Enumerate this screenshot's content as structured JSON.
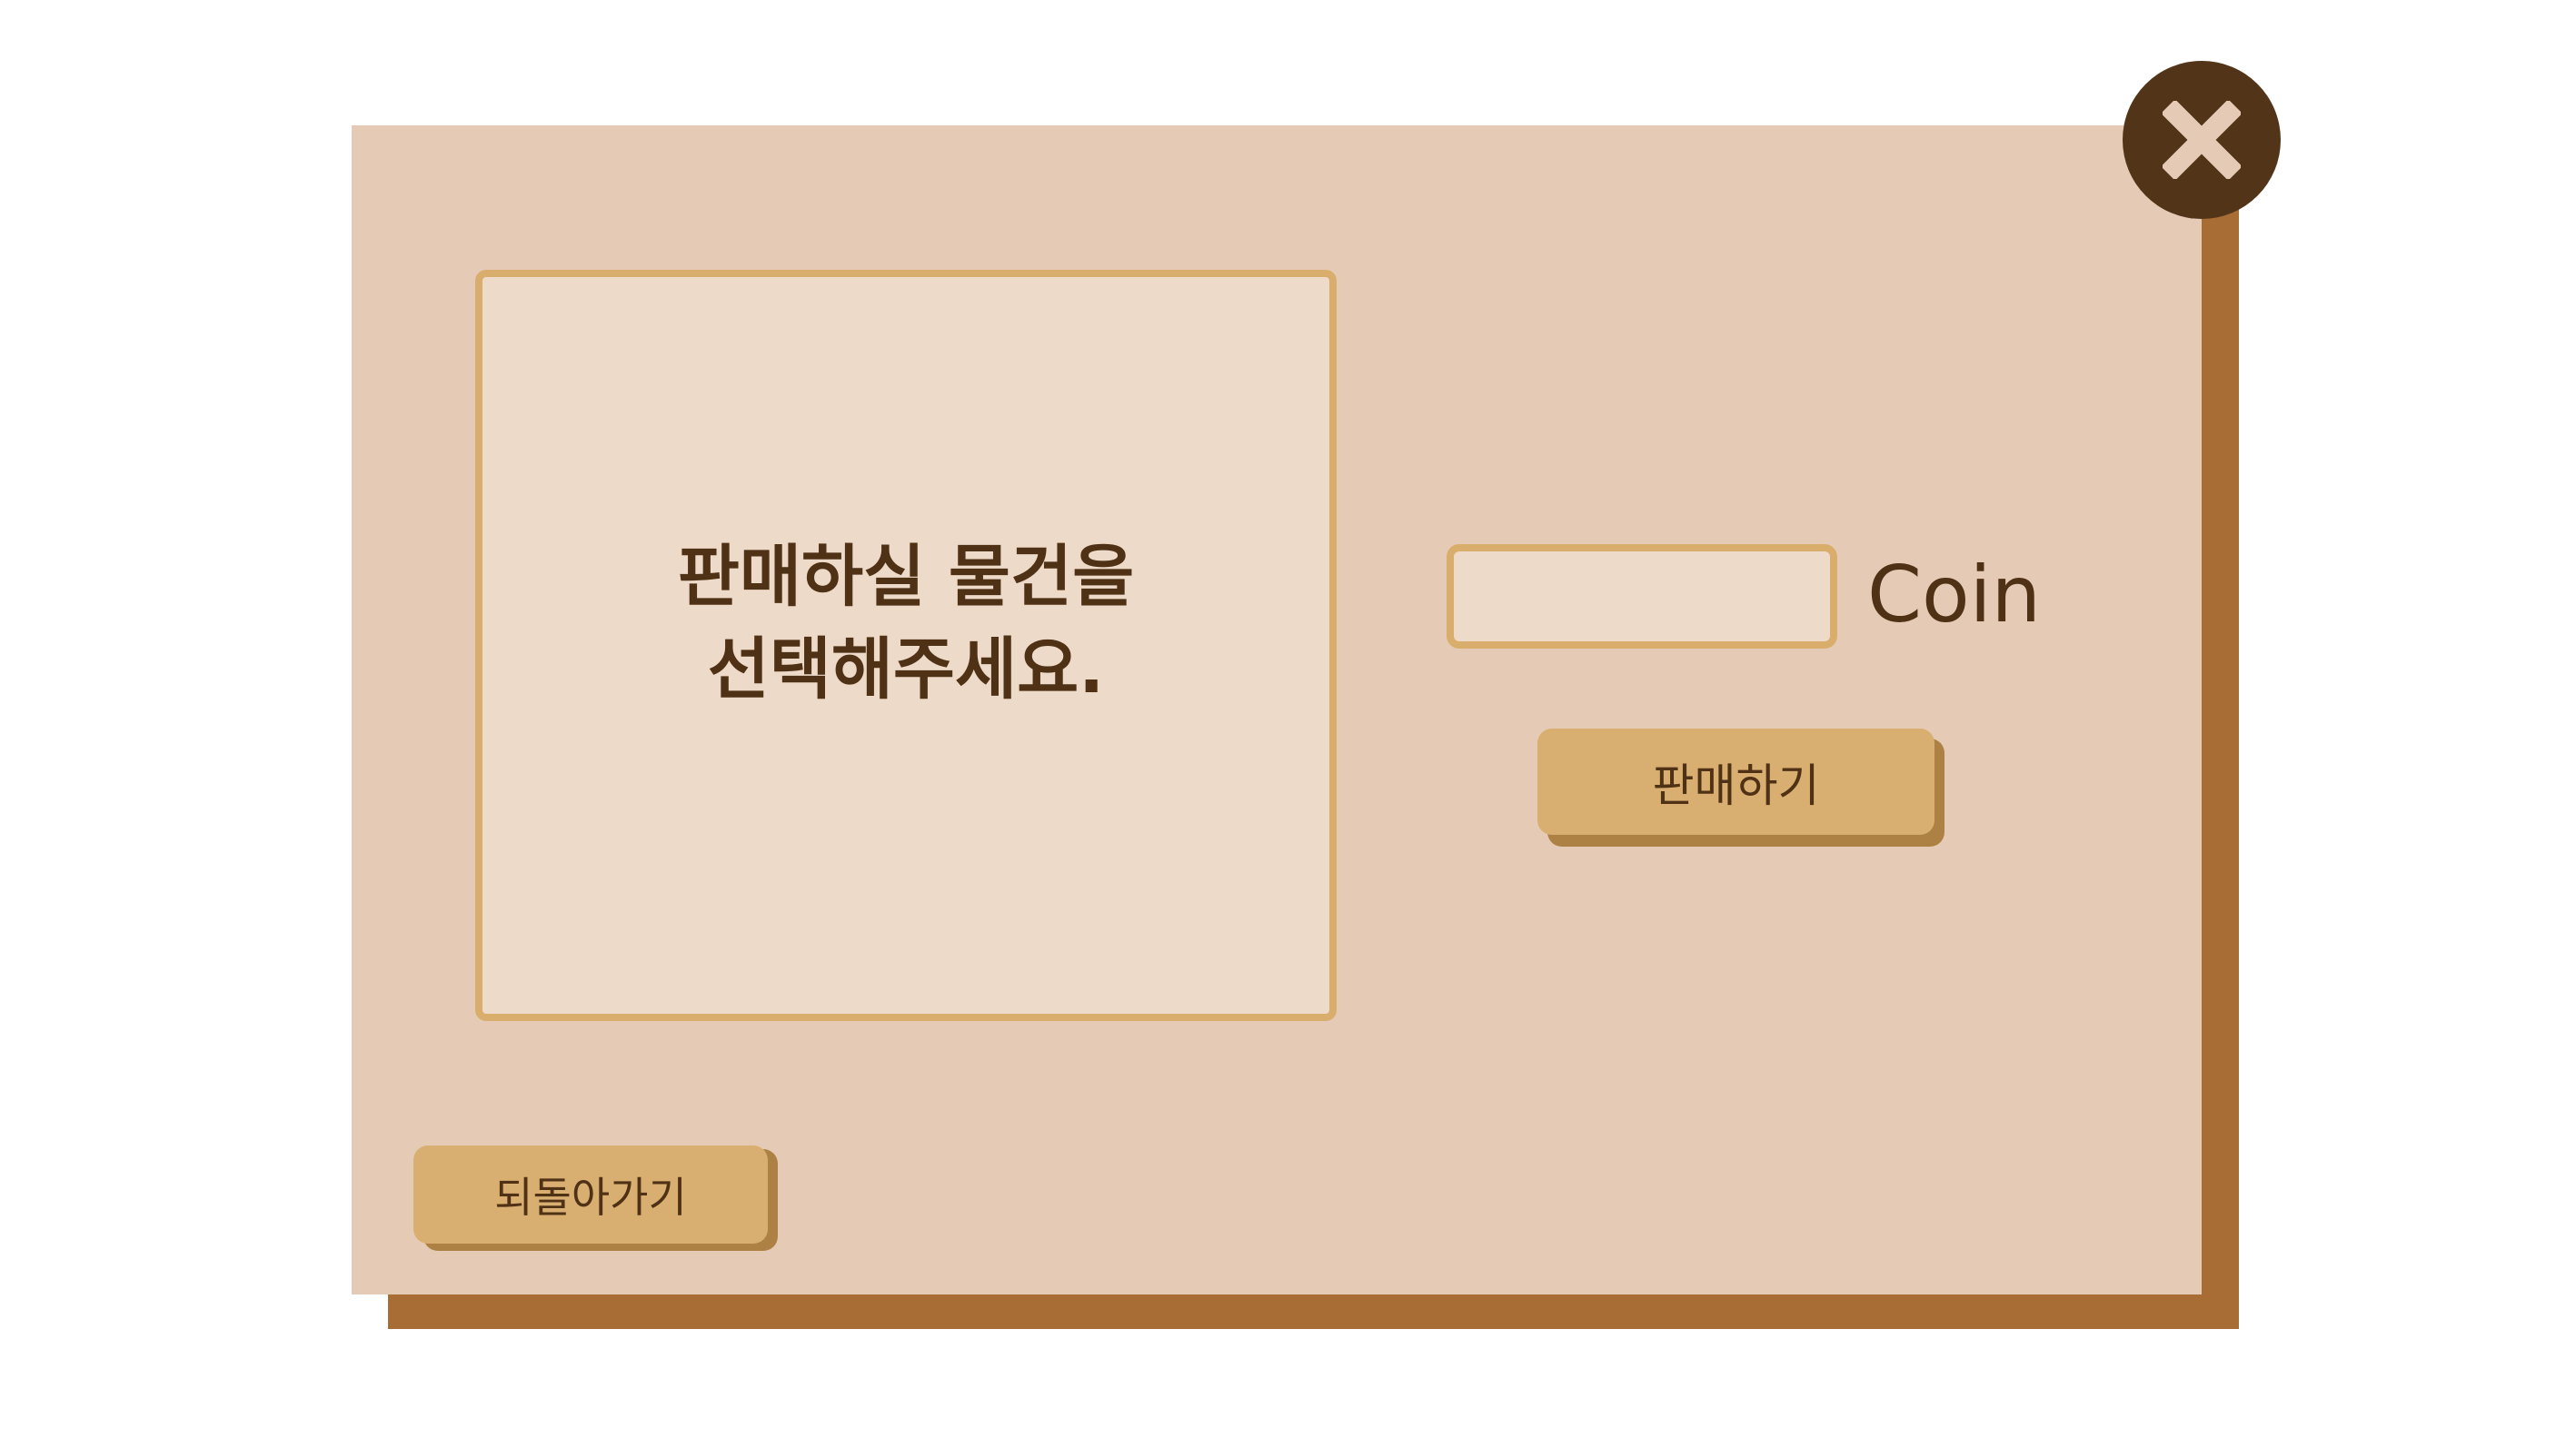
{
  "item_slot": {
    "prompt": "판매하실 물건을\n선택해주세요."
  },
  "price": {
    "value": "",
    "placeholder": "",
    "unit_label": "Coin"
  },
  "buttons": {
    "sell_label": "판매하기",
    "back_label": "되돌아가기"
  },
  "icons": {
    "close": "close-x-icon"
  },
  "colors": {
    "dialog_bg": "#e5cbb6",
    "dialog_edge": "#a86d35",
    "slot_bg": "#eedac9",
    "slot_border": "#d9ad6c",
    "button_bg": "#d9af71",
    "button_shadow": "#ad8143",
    "text": "#4f3115",
    "close_bg": "#523519",
    "close_x": "#e5cbb6"
  }
}
